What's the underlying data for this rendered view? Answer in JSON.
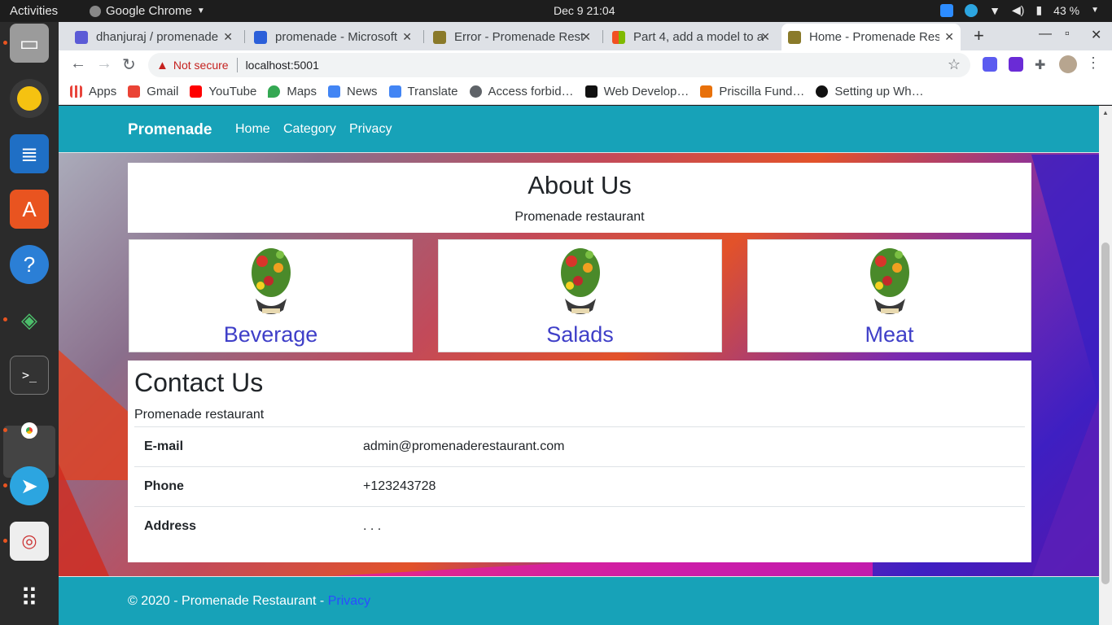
{
  "system": {
    "activities": "Activities",
    "app_name": "Google Chrome",
    "clock": "Dec 9  21:04",
    "battery": "43 %"
  },
  "browser": {
    "tabs": [
      {
        "title": "dhanjuraj / promenade",
        "color": "#5b5bd6"
      },
      {
        "title": "promenade - Microsoft",
        "color": "#2b5fd9"
      },
      {
        "title": "Error - Promenade Rest",
        "color": "#8a7a2a"
      },
      {
        "title": "Part 4, add a model to a",
        "color": "#f25022"
      },
      {
        "title": "Home - Promenade Res",
        "color": "#8a7a2a"
      }
    ],
    "security_label": "Not secure",
    "url": "localhost:5001",
    "bookmarks": [
      {
        "label": "Apps",
        "color": "#e8453c"
      },
      {
        "label": "Gmail",
        "color": "#ea4335"
      },
      {
        "label": "YouTube",
        "color": "#ff0000"
      },
      {
        "label": "Maps",
        "color": "#34a853"
      },
      {
        "label": "News",
        "color": "#4285f4"
      },
      {
        "label": "Translate",
        "color": "#4285f4"
      },
      {
        "label": "Access forbid…",
        "color": "#5f6368"
      },
      {
        "label": "Web Develop…",
        "color": "#111111"
      },
      {
        "label": "Priscilla Fund…",
        "color": "#e8710a"
      },
      {
        "label": "Setting up Wh…",
        "color": "#111111"
      }
    ]
  },
  "site": {
    "brand": "Promenade",
    "nav": [
      "Home",
      "Category",
      "Privacy"
    ],
    "about": {
      "title": "About Us",
      "text": "Promenade restaurant"
    },
    "categories": [
      "Beverage",
      "Salads",
      "Meat"
    ],
    "contact": {
      "title": "Contact Us",
      "subtitle": "Promenade restaurant",
      "rows": [
        {
          "key": "E-mail",
          "value": "admin@promenaderestaurant.com"
        },
        {
          "key": "Phone",
          "value": "+123243728"
        },
        {
          "key": "Address",
          "value": ". . ."
        }
      ]
    },
    "footer": {
      "text": "© 2020 - Promenade Restaurant - ",
      "link": "Privacy"
    },
    "colors": {
      "navbar": "#17a2b8",
      "category_text": "#3f3fc8"
    }
  }
}
